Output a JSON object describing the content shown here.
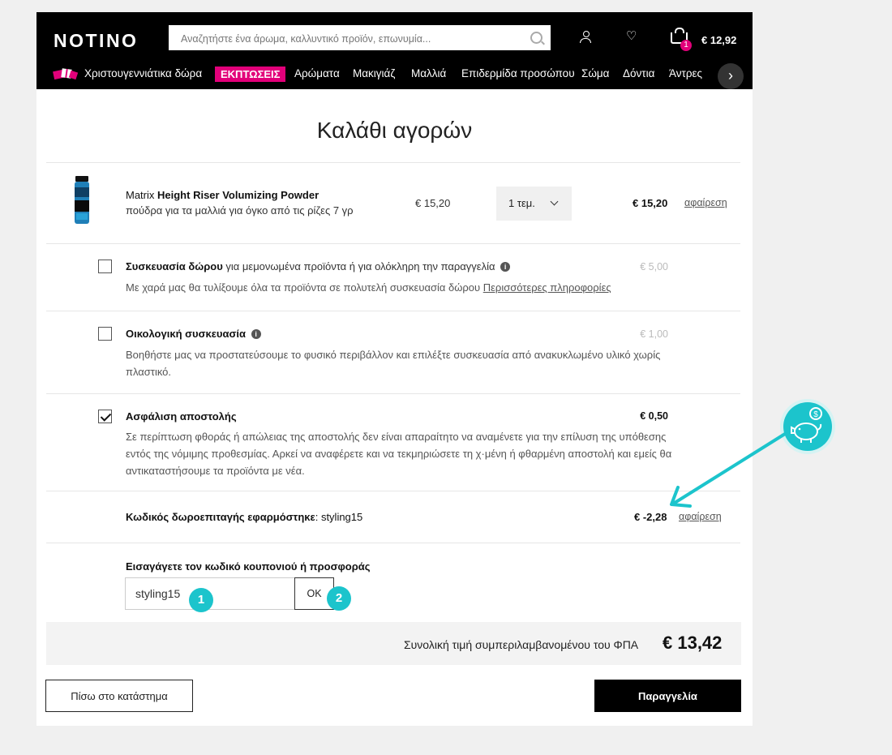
{
  "header": {
    "logo": "NOTINO",
    "search_placeholder": "Αναζητήστε ένα άρωμα, καλλυντικό προϊόν, επωνυμία...",
    "cart_count": "1",
    "cart_total": "€ 12,92"
  },
  "nav": {
    "items": [
      "Χριστουγεννιάτικα δώρα",
      "ΕΚΠΤΩΣΕΙΣ",
      "Αρώματα",
      "Μακιγιάζ",
      "Μαλλιά",
      "Επιδερμίδα προσώπου",
      "Σώμα",
      "Δόντια",
      "Άντρες"
    ],
    "next_glyph": "›"
  },
  "cart": {
    "title": "Καλάθι αγορών",
    "product": {
      "brand": "Matrix",
      "name": "Height Riser Volumizing Powder",
      "description": "πούδρα για τα μαλλιά για όγκο από τις ρίζες 7 γρ",
      "unit_price": "€ 15,20",
      "quantity": "1 τεμ.",
      "line_total": "€ 15,20",
      "remove_label": "αφαίρεση"
    },
    "options": [
      {
        "title": "Συσκευασία δώρου",
        "subtitle": "για μεμονωμένα προϊόντα ή για ολόκληρη την παραγγελία",
        "description": "Με χαρά μας θα τυλίξουμε όλα τα προϊόντα σε πολυτελή συσκευασία δώρου",
        "link": "Περισσότερες πληροφορίες",
        "price": "€ 5,00",
        "checked": false
      },
      {
        "title": "Οικολογική συσκευασία",
        "description": "Βοηθήστε μας να προστατεύσουμε το φυσικό περιβάλλον και επιλέξτε συσκευασία από ανακυκλωμένο υλικό χωρίς πλαστικό.",
        "price": "€ 1,00",
        "checked": false
      },
      {
        "title": "Ασφάλιση αποστολής",
        "description": "Σε περίπτωση φθοράς ή απώλειας της αποστολής δεν είναι απαραίτητο να αναμένετε για την επίλυση της υπόθεσης εντός της νόμιμης προθεσμίας. Αρκεί να αναφέρετε και να τεκμηριώσετε τη χ·μένη ή φθαρμένη αποστολή και εμείς θα αντικαταστήσουμε τα προϊόντα με νέα.",
        "price": "€ 0,50",
        "checked": true
      }
    ],
    "coupon": {
      "applied_label": "Κωδικός δωροεπιταγής εφαρμόστηκε",
      "applied_code": ": styling15",
      "discount": "€ -2,28",
      "remove_label": "αφαίρεση",
      "input_label": "Εισαγάγετε τον κωδικό κουπονιού ή προσφοράς",
      "input_value": "styling15",
      "ok_label": "OK"
    },
    "total_label": "Συνολική τιμή συμπεριλαμβανομένου του ΦΠΑ",
    "total_value": "€ 13,42",
    "back_label": "Πίσω στο κατάστημα",
    "order_label": "Παραγγελία"
  },
  "annotations": {
    "marker_1": "1",
    "marker_2": "2",
    "accent_color": "#1cc4cc",
    "piggy_icon": "piggy-bank-coin-icon"
  },
  "colors": {
    "brand_pink": "#e2007a",
    "header_black": "#000000"
  }
}
